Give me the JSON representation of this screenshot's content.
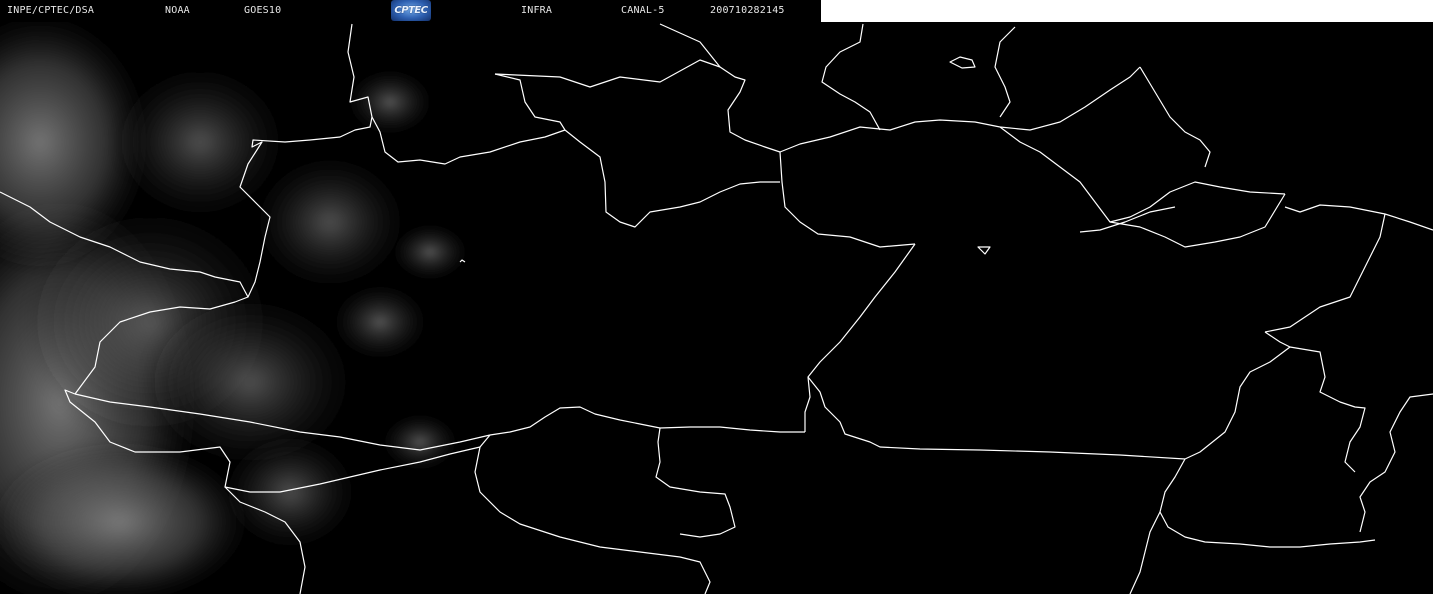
{
  "header": {
    "institution": "INPE/CPTEC/DSA",
    "agency": "NOAA",
    "satellite": "GOES10",
    "logo_text": "CPTEC",
    "channel_type": "INFRA",
    "channel": "CANAL-5",
    "timestamp": "200710282145"
  },
  "colors": {
    "background": "#000000",
    "border_lines": "#ffffff",
    "header_text": "#e8e8e8",
    "logo_blue": "#2d5fb0"
  },
  "map": {
    "type": "satellite infrared image",
    "region": "northern South America",
    "features": [
      "political borders",
      "state borders",
      "cloud cover"
    ]
  }
}
